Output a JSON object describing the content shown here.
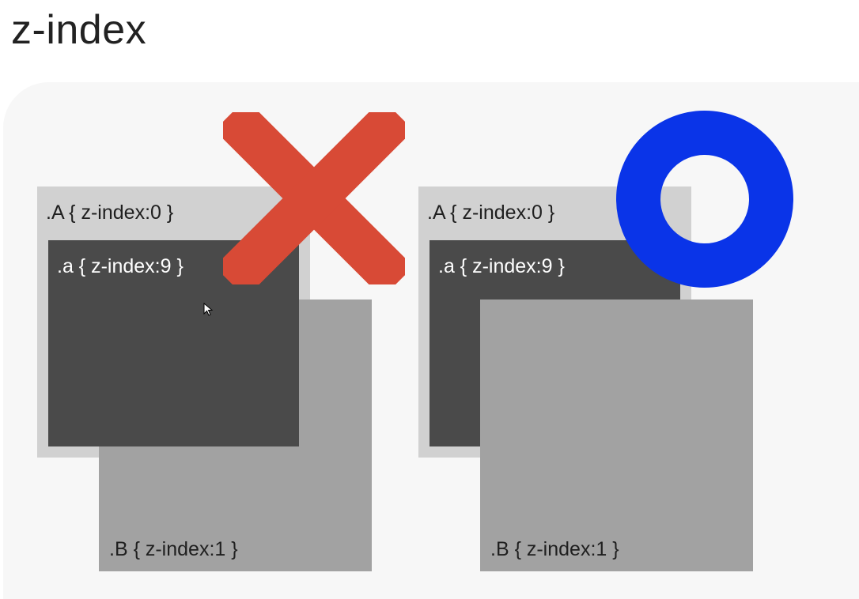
{
  "title": "z-index",
  "examples": [
    {
      "verdict": "wrong",
      "verdict_icon": "cross-icon",
      "A_label": ".A { z-index:0 }",
      "a_label": ".a { z-index:9 }",
      "B_label": ".B { z-index:1 }"
    },
    {
      "verdict": "correct",
      "verdict_icon": "circle-icon",
      "A_label": ".A { z-index:0 }",
      "a_label": ".a { z-index:9 }",
      "B_label": ".B { z-index:1 }"
    }
  ],
  "colors": {
    "box_A": "#d1d1d1",
    "box_a": "#4a4a4a",
    "box_B": "#a2a2a2",
    "cross": "#d84a36",
    "circle": "#0a34e8"
  }
}
